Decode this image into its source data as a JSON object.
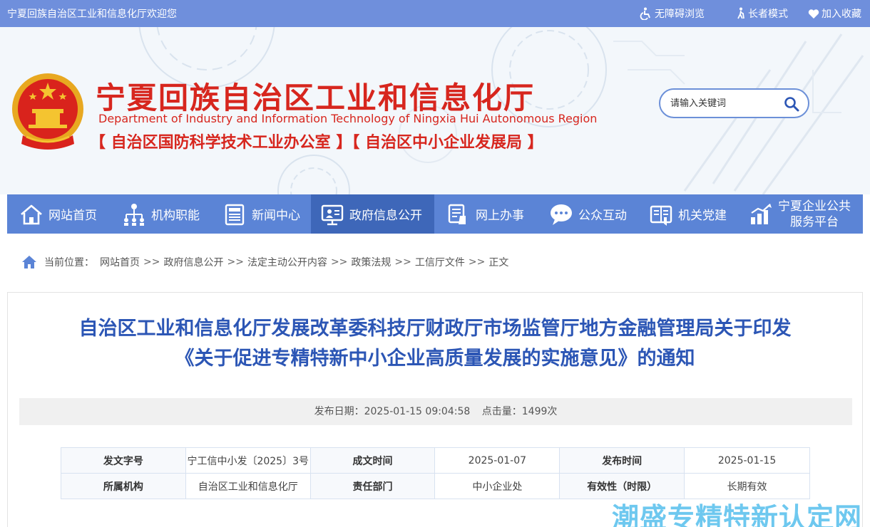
{
  "topbar": {
    "welcome": "宁夏回族自治区工业和信息化厅欢迎您",
    "accessible": "无障碍浏览",
    "elder": "长者模式",
    "favorite": "加入收藏"
  },
  "header": {
    "title": "宁夏回族自治区工业和信息化厅",
    "english": "Department of Industry and Information Technology of Ningxia Hui Autonomous Region",
    "subtitle": "【 自治区国防科学技术工业办公室 】【 自治区中小企业发展局 】",
    "search_placeholder": "请输入关键词"
  },
  "nav": [
    {
      "label": "网站首页",
      "icon": "home-icon"
    },
    {
      "label": "机构职能",
      "icon": "org-chart-icon"
    },
    {
      "label": "新闻中心",
      "icon": "newspaper-icon"
    },
    {
      "label": "政府信息公开",
      "icon": "monitor-icon"
    },
    {
      "label": "网上办事",
      "icon": "online-service-icon"
    },
    {
      "label": "公众互动",
      "icon": "chat-bubble-icon"
    },
    {
      "label": "机关党建",
      "icon": "document-icon"
    },
    {
      "label": "宁夏企业公共",
      "label2": "服务平台",
      "icon": "bar-chart-icon"
    }
  ],
  "breadcrumb": {
    "prefix": "当前位置：",
    "items": [
      "网站首页",
      "政府信息公开",
      "法定主动公开内容",
      "政策法规",
      "工信厅文件",
      "正文"
    ],
    "separator": ">>"
  },
  "article": {
    "title_line1": "自治区工业和信息化厅发展改革委科技厅财政厅市场监管厅地方金融管理局关于印发",
    "title_line2": "《关于促进专精特新中小企业高质量发展的实施意见》的通知",
    "publish_label": "发布日期：",
    "publish_value": "2025-01-15 09:04:58",
    "clicks_label": "点击量：",
    "clicks_value": "1499次"
  },
  "info_table": {
    "rows": [
      [
        "发文字号",
        "宁工信中小发〔2025〕3号",
        "成文时间",
        "2025-01-07",
        "发布时间",
        "2025-01-15"
      ],
      [
        "所属机构",
        "自治区工业和信息化厅",
        "责任部门",
        "中小企业处",
        "有效性（时限）",
        "长期有效"
      ]
    ]
  },
  "watermark": "潮盛专精特新认定网",
  "colors": {
    "topbar": "#6f8fdc",
    "nav": "#5b84d6",
    "nav_active": "#3e67b9",
    "title_red": "#d7261e",
    "article_blue": "#2c56b5"
  }
}
